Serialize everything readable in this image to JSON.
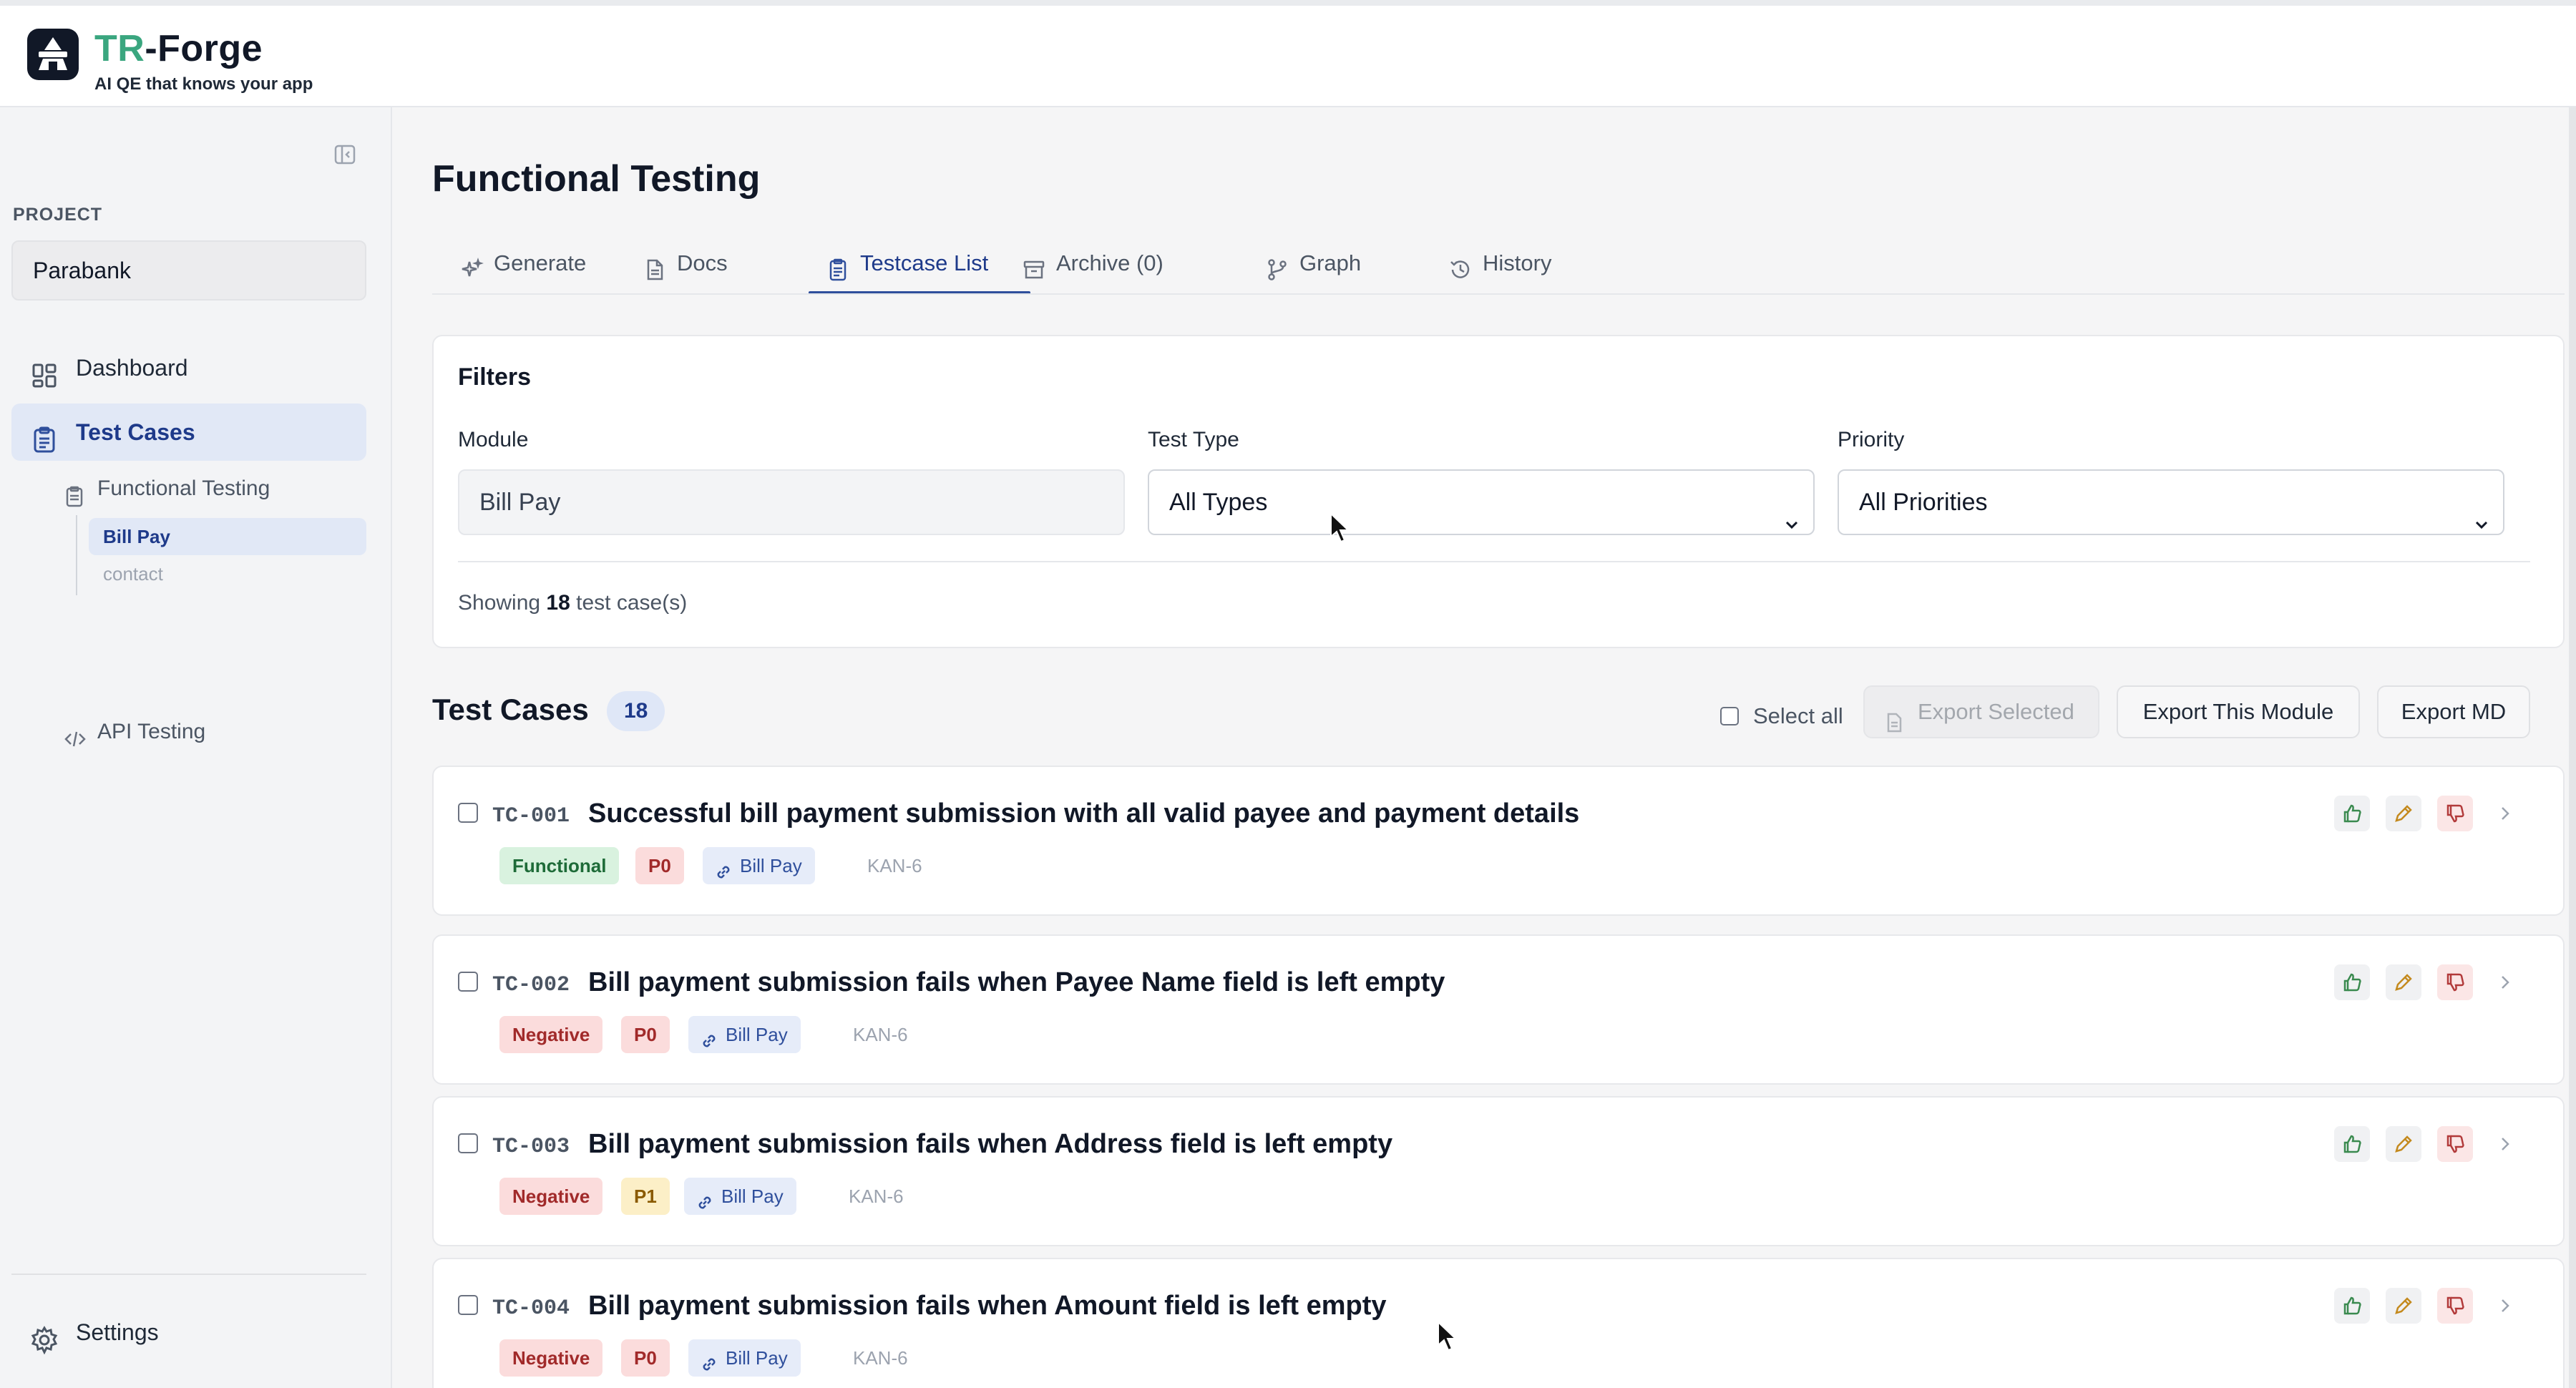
{
  "app": {
    "brand_accent": "TR",
    "brand_rest": "-Forge",
    "tagline": "AI QE that knows your app",
    "colors": {
      "brand": "#3aa67f",
      "primary": "#2f4f9c",
      "selected_bg": "#e1e8f6"
    }
  },
  "sidebar": {
    "project_label": "PROJECT",
    "project_value": "Parabank",
    "nav": {
      "dashboard": "Dashboard",
      "test_cases": "Test Cases",
      "functional_testing": "Functional Testing",
      "modules": [
        "Bill Pay",
        "contact"
      ],
      "api_testing": "API Testing",
      "settings": "Settings"
    },
    "icons": [
      "sidebar-collapse-icon",
      "dashboard-grid-icon",
      "clipboard-icon",
      "code-icon",
      "gear-icon"
    ]
  },
  "main": {
    "title": "Functional Testing",
    "tabs": [
      {
        "label": "Generate",
        "icon": "sparkles-icon"
      },
      {
        "label": "Docs",
        "icon": "document-icon"
      },
      {
        "label": "Testcase List",
        "icon": "clipboard-list-icon",
        "active": true
      },
      {
        "label": "Archive (0)",
        "icon": "archive-box-icon"
      },
      {
        "label": "Graph",
        "icon": "git-branch-icon"
      },
      {
        "label": "History",
        "icon": "history-icon"
      }
    ],
    "filters": {
      "title": "Filters",
      "module_label": "Module",
      "module_value": "Bill Pay",
      "type_label": "Test Type",
      "type_value": "All Types",
      "priority_label": "Priority",
      "priority_value": "All Priorities",
      "showing_prefix": "Showing",
      "showing_count": "18",
      "showing_suffix": "test case(s)"
    },
    "list": {
      "title": "Test Cases",
      "count": "18",
      "select_all": "Select all",
      "export_selected": "Export Selected",
      "export_module": "Export This Module",
      "export_md": "Export MD"
    },
    "test_cases": [
      {
        "id": "TC-001",
        "name": "Successful bill payment submission with all valid payee and payment details",
        "type": "Functional",
        "priority": "P0",
        "module": "Bill Pay",
        "ticket": "KAN-6"
      },
      {
        "id": "TC-002",
        "name": "Bill payment submission fails when Payee Name field is left empty",
        "type": "Negative",
        "priority": "P0",
        "module": "Bill Pay",
        "ticket": "KAN-6"
      },
      {
        "id": "TC-003",
        "name": "Bill payment submission fails when Address field is left empty",
        "type": "Negative",
        "priority": "P1",
        "module": "Bill Pay",
        "ticket": "KAN-6"
      },
      {
        "id": "TC-004",
        "name": "Bill payment submission fails when Amount field is left empty",
        "type": "Negative",
        "priority": "P0",
        "module": "Bill Pay",
        "ticket": "KAN-6"
      }
    ]
  }
}
